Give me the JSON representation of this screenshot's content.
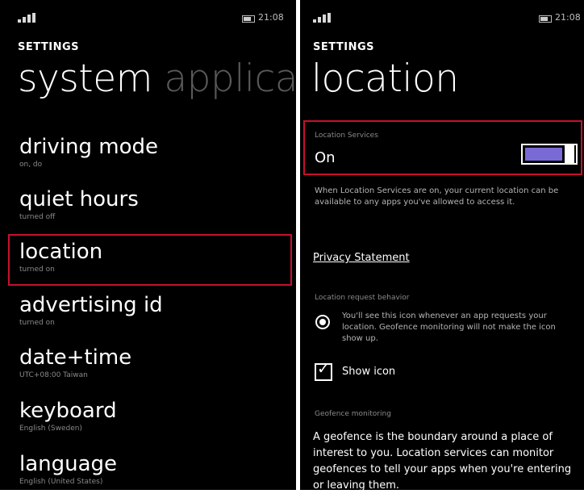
{
  "left_screen": {
    "status_time": "21:08",
    "settings_label": "SETTINGS",
    "pivot": {
      "active": "system",
      "inactive": "applica"
    },
    "items": [
      {
        "title": "driving mode",
        "subtitle": "on, do"
      },
      {
        "title": "quiet hours",
        "subtitle": "turned off"
      },
      {
        "title": "location",
        "subtitle": "turned on"
      },
      {
        "title": "advertising id",
        "subtitle": "turned on"
      },
      {
        "title": "date+time",
        "subtitle": "UTC+08:00 Taiwan"
      },
      {
        "title": "keyboard",
        "subtitle": "English (Sweden)"
      },
      {
        "title": "language",
        "subtitle": "English (United States)"
      }
    ]
  },
  "right_screen": {
    "status_time": "21:08",
    "settings_label": "SETTINGS",
    "page_title": "location",
    "location_services": {
      "label": "Location Services",
      "state": "On",
      "toggle_on": true
    },
    "description": "When Location Services are on, your current location can be available to any apps you've allowed to access it.",
    "privacy_link": "Privacy Statement",
    "request_section_label": "Location request behavior",
    "request_option_text": "You'll see this icon whenever an app requests your location. Geofence monitoring will not make the icon show up.",
    "show_icon_label": "Show icon",
    "show_icon_checked": true,
    "geofence_section_label": "Geofence monitoring",
    "geofence_text": "A geofence is the boundary around a place of interest to you. Location services can monitor geofences to tell your apps when you're entering or leaving them."
  },
  "colors": {
    "highlight": "#c8102e",
    "accent": "#7a6ad6"
  }
}
